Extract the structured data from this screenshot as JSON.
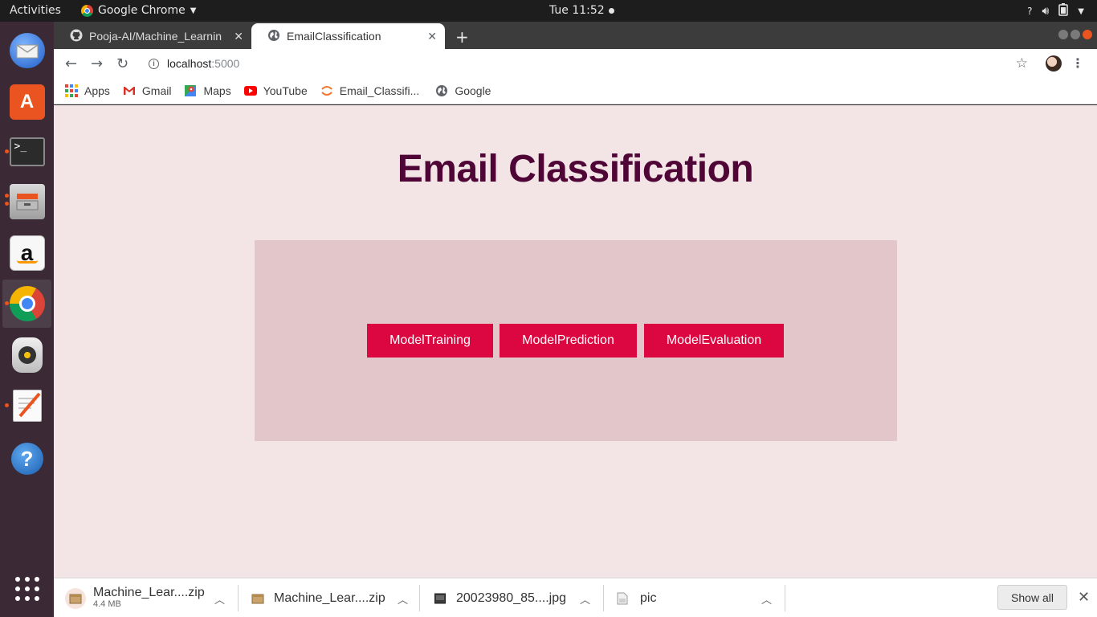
{
  "topbar": {
    "activities": "Activities",
    "app_name": "Google Chrome",
    "clock": "Tue 11:52",
    "tray_icons": [
      "help-icon",
      "volume-icon",
      "battery-icon",
      "menu-arrow-icon"
    ]
  },
  "dock": {
    "items": [
      "thunderbird-icon",
      "software-center-icon",
      "terminal-icon",
      "files-icon",
      "amazon-icon",
      "chrome-icon",
      "rhythmbox-icon",
      "text-editor-icon",
      "help-icon",
      "show-apps-icon"
    ]
  },
  "tabs": [
    {
      "title": "Pooja-AI/Machine_Learnin",
      "icon": "github-icon"
    },
    {
      "title": "EmailClassification",
      "icon": "globe-icon"
    }
  ],
  "toolbar": {
    "url_host": "localhost",
    "url_port": ":5000"
  },
  "bookmarks": [
    {
      "label": "Apps",
      "icon": "apps-icon"
    },
    {
      "label": "Gmail",
      "icon": "gmail-icon"
    },
    {
      "label": "Maps",
      "icon": "maps-icon"
    },
    {
      "label": "YouTube",
      "icon": "youtube-icon"
    },
    {
      "label": "Email_Classifi...",
      "icon": "jupyter-icon"
    },
    {
      "label": "Google",
      "icon": "globe-icon"
    }
  ],
  "page": {
    "title": "Email Classification",
    "buttons": {
      "training": "ModelTraining",
      "prediction": "ModelPrediction",
      "evaluation": "ModelEvaluation"
    }
  },
  "downloads": {
    "items": [
      {
        "name": "Machine_Lear....zip",
        "size": "4.4 MB"
      },
      {
        "name": "Machine_Lear....zip"
      },
      {
        "name": "20023980_85....jpg"
      },
      {
        "name": "pic"
      }
    ],
    "show_all": "Show all"
  },
  "colors": {
    "page_bg": "#f3e5e6",
    "panel_bg": "#e2c6c9",
    "button_bg": "#dc0640",
    "title_color": "#4f0535"
  }
}
